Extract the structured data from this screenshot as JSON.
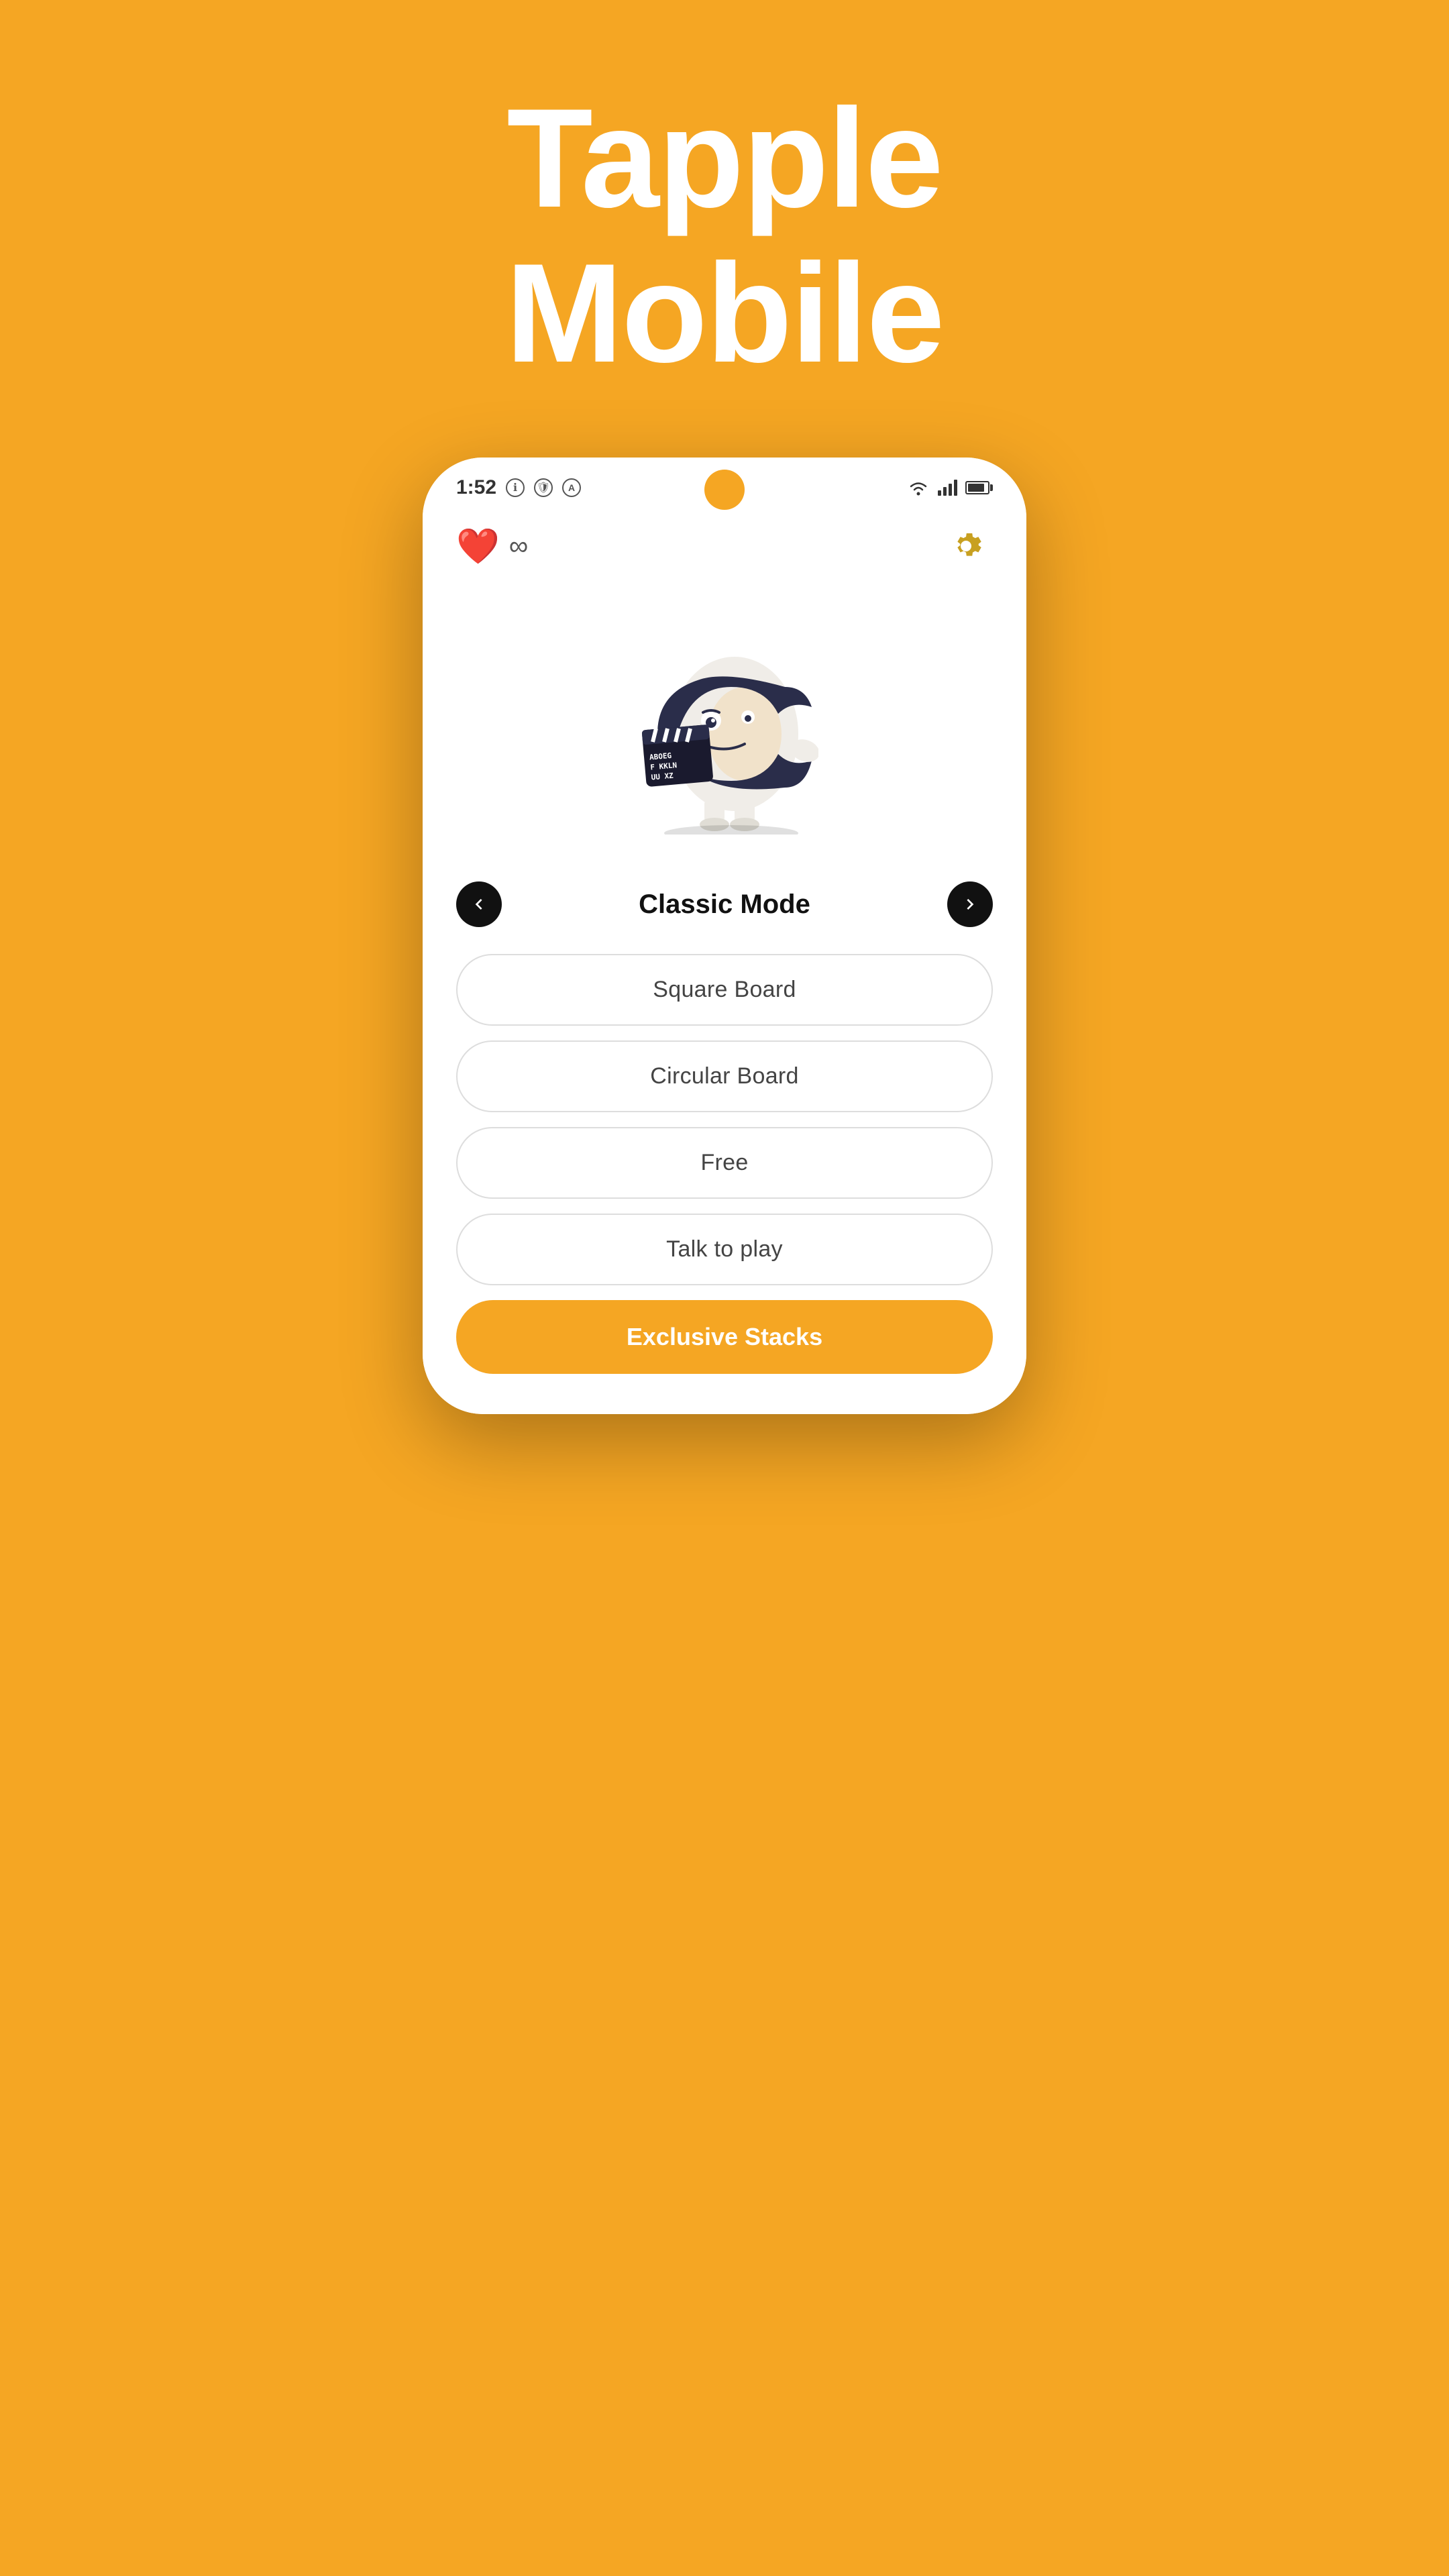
{
  "app": {
    "title_line1": "Tapple",
    "title_line2": "Mobile"
  },
  "status_bar": {
    "time": "1:52",
    "icons": [
      "info",
      "shield",
      "A"
    ]
  },
  "top_bar": {
    "heart_label": "❤️",
    "infinity_label": "∞",
    "gear_label": "Settings"
  },
  "mode": {
    "title": "Classic Mode"
  },
  "buttons": {
    "square_board": "Square Board",
    "circular_board": "Circular Board",
    "free": "Free",
    "talk_to_play": "Talk to play",
    "exclusive_stacks": "Exclusive Stacks"
  },
  "arrow_left": "←",
  "arrow_right": "→"
}
